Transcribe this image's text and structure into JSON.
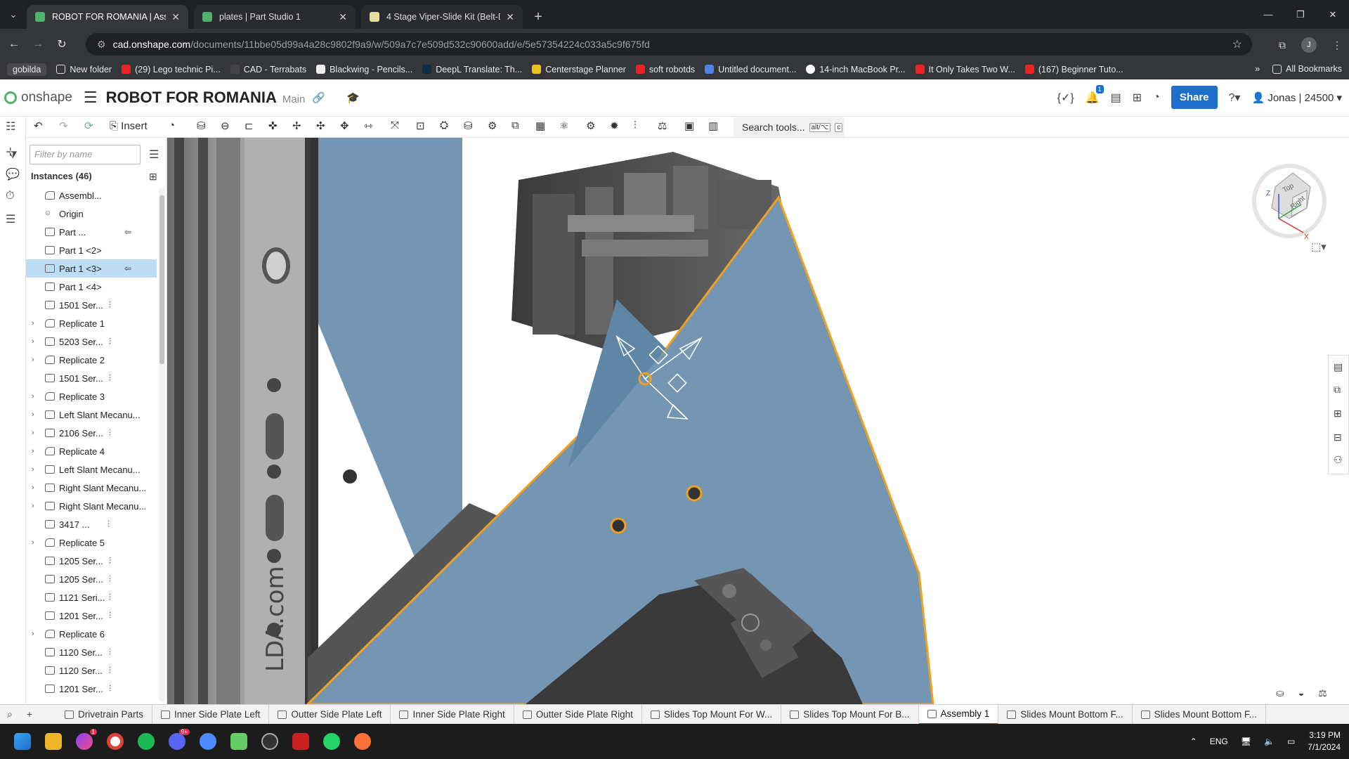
{
  "browser": {
    "tabs": [
      {
        "title": "ROBOT FOR ROMANIA | Assem",
        "active": true
      },
      {
        "title": "plates | Part Studio 1",
        "active": false
      },
      {
        "title": "4 Stage Viper-Slide Kit (Belt-Dri",
        "active": false
      }
    ],
    "url_host": "cad.onshape.com",
    "url_path": "/documents/11bbe05d99a4a28c9802f9a9/w/509a7c7e509d532c90600add/e/5e57354224c033a5c9f675fd",
    "profile_initial": "J",
    "bookmarks": [
      "gobilda",
      "New folder",
      "(29) Lego technic Pi...",
      "CAD - Terrabats",
      "Blackwing - Pencils...",
      "DeepL Translate: Th...",
      "Centerstage Planner",
      "soft robotds",
      "Untitled document...",
      "14-inch MacBook Pr...",
      "It Only Takes Two W...",
      "(167) Beginner Tuto..."
    ],
    "all_bookmarks": "All Bookmarks"
  },
  "onshape": {
    "logo_text": "onshape",
    "doc_title": "ROBOT FOR ROMANIA",
    "branch": "Main",
    "notification_count": "1",
    "share_label": "Share",
    "user_label": "Jonas | 24500",
    "insert_label": "Insert",
    "search_tools_label": "Search tools...",
    "search_shortcut_1": "alt/⌥",
    "search_shortcut_2": "c"
  },
  "instances": {
    "filter_placeholder": "Filter by name",
    "title": "Instances (46)",
    "items": [
      {
        "label": "Assembl...",
        "caret": false,
        "sel": false,
        "type": "asm"
      },
      {
        "label": "Origin",
        "caret": false,
        "sel": false,
        "type": "origin"
      },
      {
        "label": "Part ...",
        "caret": false,
        "sel": false,
        "type": "part"
      },
      {
        "label": "Part 1 <2>",
        "caret": false,
        "sel": false,
        "type": "part"
      },
      {
        "label": "Part 1 <3>",
        "caret": false,
        "sel": true,
        "type": "part"
      },
      {
        "label": "Part 1 <4>",
        "caret": false,
        "sel": false,
        "type": "part"
      },
      {
        "label": "1501 Ser...",
        "caret": false,
        "sel": false,
        "type": "part"
      },
      {
        "label": "Replicate 1",
        "caret": true,
        "sel": false,
        "type": "asm"
      },
      {
        "label": "5203 Ser...",
        "caret": true,
        "sel": false,
        "type": "part"
      },
      {
        "label": "Replicate 2",
        "caret": true,
        "sel": false,
        "type": "asm"
      },
      {
        "label": "1501 Ser...",
        "caret": false,
        "sel": false,
        "type": "part"
      },
      {
        "label": "Replicate 3",
        "caret": true,
        "sel": false,
        "type": "asm"
      },
      {
        "label": "Left Slant Mecanu...",
        "caret": true,
        "sel": false,
        "type": "part"
      },
      {
        "label": "2106 Ser...",
        "caret": true,
        "sel": false,
        "type": "part"
      },
      {
        "label": "Replicate 4",
        "caret": true,
        "sel": false,
        "type": "asm"
      },
      {
        "label": "Left Slant Mecanu...",
        "caret": true,
        "sel": false,
        "type": "part"
      },
      {
        "label": "Right Slant Mecanu...",
        "caret": true,
        "sel": false,
        "type": "part"
      },
      {
        "label": "Right Slant Mecanu...",
        "caret": true,
        "sel": false,
        "type": "part"
      },
      {
        "label": "3417 ...",
        "caret": false,
        "sel": false,
        "type": "part"
      },
      {
        "label": "Replicate 5",
        "caret": true,
        "sel": false,
        "type": "asm"
      },
      {
        "label": "1205 Ser...",
        "caret": false,
        "sel": false,
        "type": "part"
      },
      {
        "label": "1205 Ser...",
        "caret": false,
        "sel": false,
        "type": "part"
      },
      {
        "label": "1121 Seri...",
        "caret": false,
        "sel": false,
        "type": "part"
      },
      {
        "label": "1201 Ser...",
        "caret": false,
        "sel": false,
        "type": "part"
      },
      {
        "label": "Replicate 6",
        "caret": true,
        "sel": false,
        "type": "asm"
      },
      {
        "label": "1120 Ser...",
        "caret": false,
        "sel": false,
        "type": "part"
      },
      {
        "label": "1120 Ser...",
        "caret": false,
        "sel": false,
        "type": "part"
      },
      {
        "label": "1201 Ser...",
        "caret": false,
        "sel": false,
        "type": "part"
      }
    ]
  },
  "viewport": {
    "rail_text": "LDA.com",
    "viewcube_top": "Top",
    "viewcube_right": "Right",
    "axis_z": "Z",
    "axis_x": "X",
    "plate_color": "#7496b3",
    "highlight_color": "#f0a020"
  },
  "bottom_tabs": [
    {
      "label": "Drivetrain Parts",
      "active": false
    },
    {
      "label": "Inner Side Plate Left",
      "active": false
    },
    {
      "label": "Outter Side Plate Left",
      "active": false
    },
    {
      "label": "Inner Side Plate Right",
      "active": false
    },
    {
      "label": "Outter Side Plate Right",
      "active": false
    },
    {
      "label": "Slides Top Mount For W...",
      "active": false
    },
    {
      "label": "Slides Top Mount For B...",
      "active": false
    },
    {
      "label": "Assembly 1",
      "active": true
    },
    {
      "label": "Slides Mount Bottom F...",
      "active": false
    },
    {
      "label": "Slides Mount Bottom F...",
      "active": false
    }
  ],
  "taskbar": {
    "lang": "ENG",
    "time": "3:19 PM",
    "date": "7/1/2024",
    "messenger_badge": "1",
    "discord_badge": "9+"
  }
}
